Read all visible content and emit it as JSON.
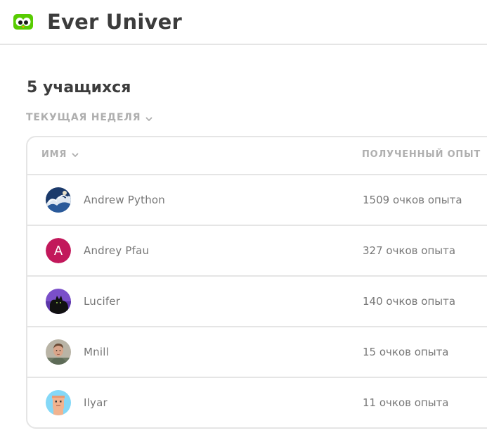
{
  "header": {
    "logo_icon": "duolingo-owl-icon",
    "class_name": "Ever Univer"
  },
  "summary": {
    "students_count": "5 учащихся"
  },
  "filter": {
    "period_label": "ТЕКУЩАЯ НЕДЕЛЯ",
    "period_icon": "chevron-down-icon"
  },
  "table": {
    "columns": {
      "name": "ИМЯ",
      "name_icon": "chevron-down-icon",
      "xp": "ПОЛУЧЕННЫЙ ОПЫТ"
    },
    "rows": [
      {
        "name": "Andrew Python",
        "xp": "1509 очков опыта",
        "avatar": "photo-wave-avatar"
      },
      {
        "name": "Andrey Pfau",
        "xp": "327 очков опыта",
        "avatar_letter": "A",
        "avatar_color": "#c2185b"
      },
      {
        "name": "Lucifer",
        "xp": "140 очков опыта",
        "avatar": "photo-cat-avatar"
      },
      {
        "name": "Mnill",
        "xp": "15 очков опыта",
        "avatar": "photo-person-avatar"
      },
      {
        "name": "Ilyar",
        "xp": "11 очков опыта",
        "avatar": "cartoon-face-avatar"
      }
    ]
  },
  "colors": {
    "title": "#3c3c3c",
    "muted": "#afafaf",
    "text": "#777777",
    "border": "#e5e5e5",
    "brand_green": "#58cc02"
  }
}
